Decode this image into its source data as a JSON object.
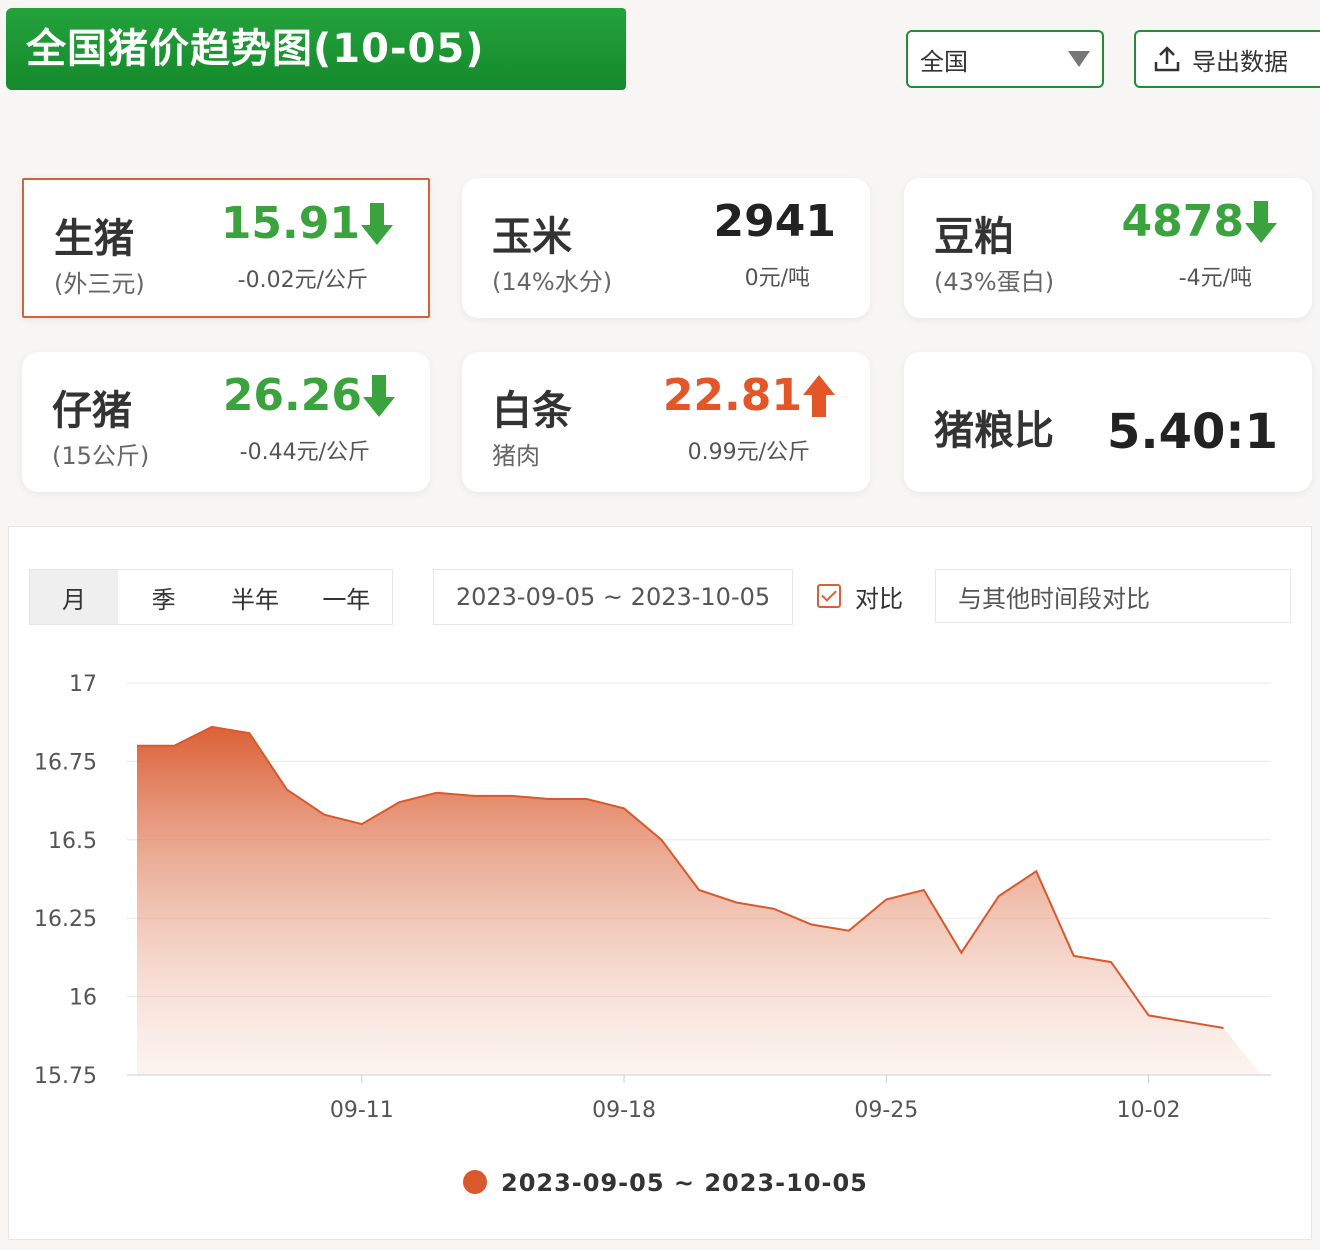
{
  "header": {
    "title": "全国猪价趋势图(10-05)",
    "region": "全国",
    "export_label": "导出数据"
  },
  "cards": [
    {
      "name": "生猪",
      "sub": "(外三元)",
      "value": "15.91",
      "direction": "down",
      "change": "-0.02元/公斤",
      "active": true
    },
    {
      "name": "玉米",
      "sub": "(14%水分)",
      "value": "2941",
      "direction": "none",
      "change": "0元/吨"
    },
    {
      "name": "豆粕",
      "sub": "(43%蛋白)",
      "value": "4878",
      "direction": "down",
      "change": "-4元/吨"
    },
    {
      "name": "仔猪",
      "sub": "(15公斤)",
      "value": "26.26",
      "direction": "down",
      "change": "-0.44元/公斤"
    },
    {
      "name": "白条",
      "sub": "猪肉",
      "value": "22.81",
      "direction": "up",
      "change": "0.99元/公斤"
    },
    {
      "name": "猪粮比",
      "ratio": "5.40:1"
    }
  ],
  "controls": {
    "tabs": [
      "月",
      "季",
      "半年",
      "一年"
    ],
    "active_tab": "月",
    "date_range": "2023-09-05 ~ 2023-10-05",
    "compare_label": "对比",
    "compare_placeholder": "与其他时间段对比"
  },
  "colors": {
    "brand_green": "#1e8f34",
    "up_red": "#e45527",
    "down_green": "#3aa33e",
    "series": "#d9582c"
  },
  "chart_data": {
    "type": "area",
    "x": [
      "2023-09-05",
      "2023-09-06",
      "2023-09-07",
      "2023-09-08",
      "2023-09-09",
      "2023-09-10",
      "2023-09-11",
      "2023-09-12",
      "2023-09-13",
      "2023-09-14",
      "2023-09-15",
      "2023-09-16",
      "2023-09-17",
      "2023-09-18",
      "2023-09-19",
      "2023-09-20",
      "2023-09-21",
      "2023-09-22",
      "2023-09-23",
      "2023-09-24",
      "2023-09-25",
      "2023-09-26",
      "2023-09-27",
      "2023-09-28",
      "2023-09-29",
      "2023-09-30",
      "2023-10-01",
      "2023-10-02",
      "2023-10-03",
      "2023-10-04",
      "2023-10-05"
    ],
    "series": [
      {
        "name": "2023-09-05 ~ 2023-10-05",
        "values": [
          16.8,
          16.8,
          16.86,
          16.84,
          16.66,
          16.58,
          16.55,
          16.62,
          16.65,
          16.64,
          16.64,
          16.63,
          16.63,
          16.6,
          16.5,
          16.34,
          16.3,
          16.28,
          16.23,
          16.21,
          16.31,
          16.34,
          16.14,
          16.32,
          16.4,
          16.13,
          16.11,
          15.94,
          15.92,
          15.9
        ]
      }
    ],
    "ylim": [
      15.75,
      17
    ],
    "yticks": [
      "17",
      "16.75",
      "16.5",
      "16.25",
      "16",
      "15.75"
    ],
    "xticks": [
      "09-11",
      "09-18",
      "09-25",
      "10-02"
    ],
    "legend_position": "bottom-center",
    "grid": true
  }
}
